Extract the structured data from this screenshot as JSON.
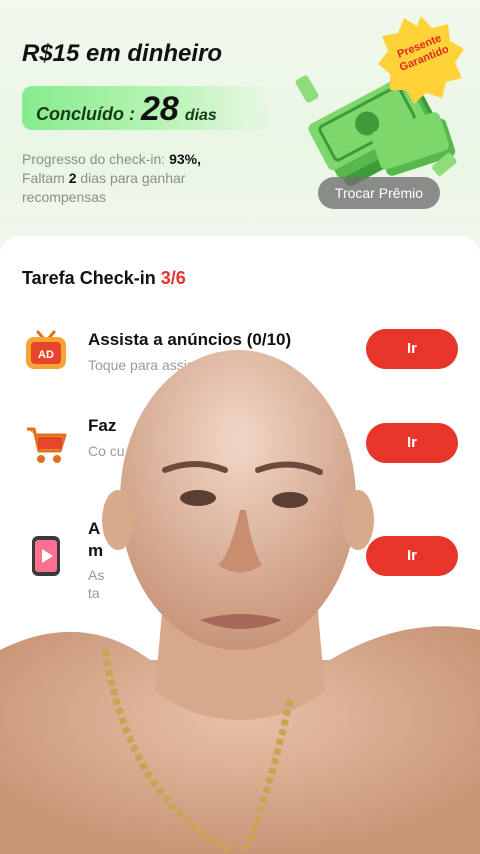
{
  "header": {
    "title": "R$15 em dinheiro",
    "completed_label": "Concluído :",
    "completed_days": "28",
    "completed_unit": "dias",
    "progress_prefix": "Progresso do check-in:",
    "progress_value": "93%,",
    "remaining_prefix": "Faltam",
    "remaining_days": "2",
    "remaining_suffix": "dias para ganhar recompensas",
    "badge_line1": "Presente",
    "badge_line2": "Garantido",
    "redeem_button": "Trocar Prêmio"
  },
  "tasks_panel": {
    "title": "Tarefa Check-in",
    "count": "3/6",
    "tasks": [
      {
        "icon": "ad-tv-icon",
        "name": "Assista a anúncios  (0/10)",
        "sub": "Toque para assistir anúncios",
        "button": "Ir"
      },
      {
        "icon": "shopping-cart-icon",
        "name": "Faz",
        "sub": "Co cu",
        "button": "Ir"
      },
      {
        "icon": "video-phone-icon",
        "name": "A m",
        "sub": "As ta",
        "button": "Ir"
      }
    ]
  },
  "overlay": {
    "type": "webcam-person-overlay"
  },
  "colors": {
    "accent_red": "#e7352b",
    "green_pill": "#86ec8e",
    "badge_yellow": "#ffd23a"
  }
}
